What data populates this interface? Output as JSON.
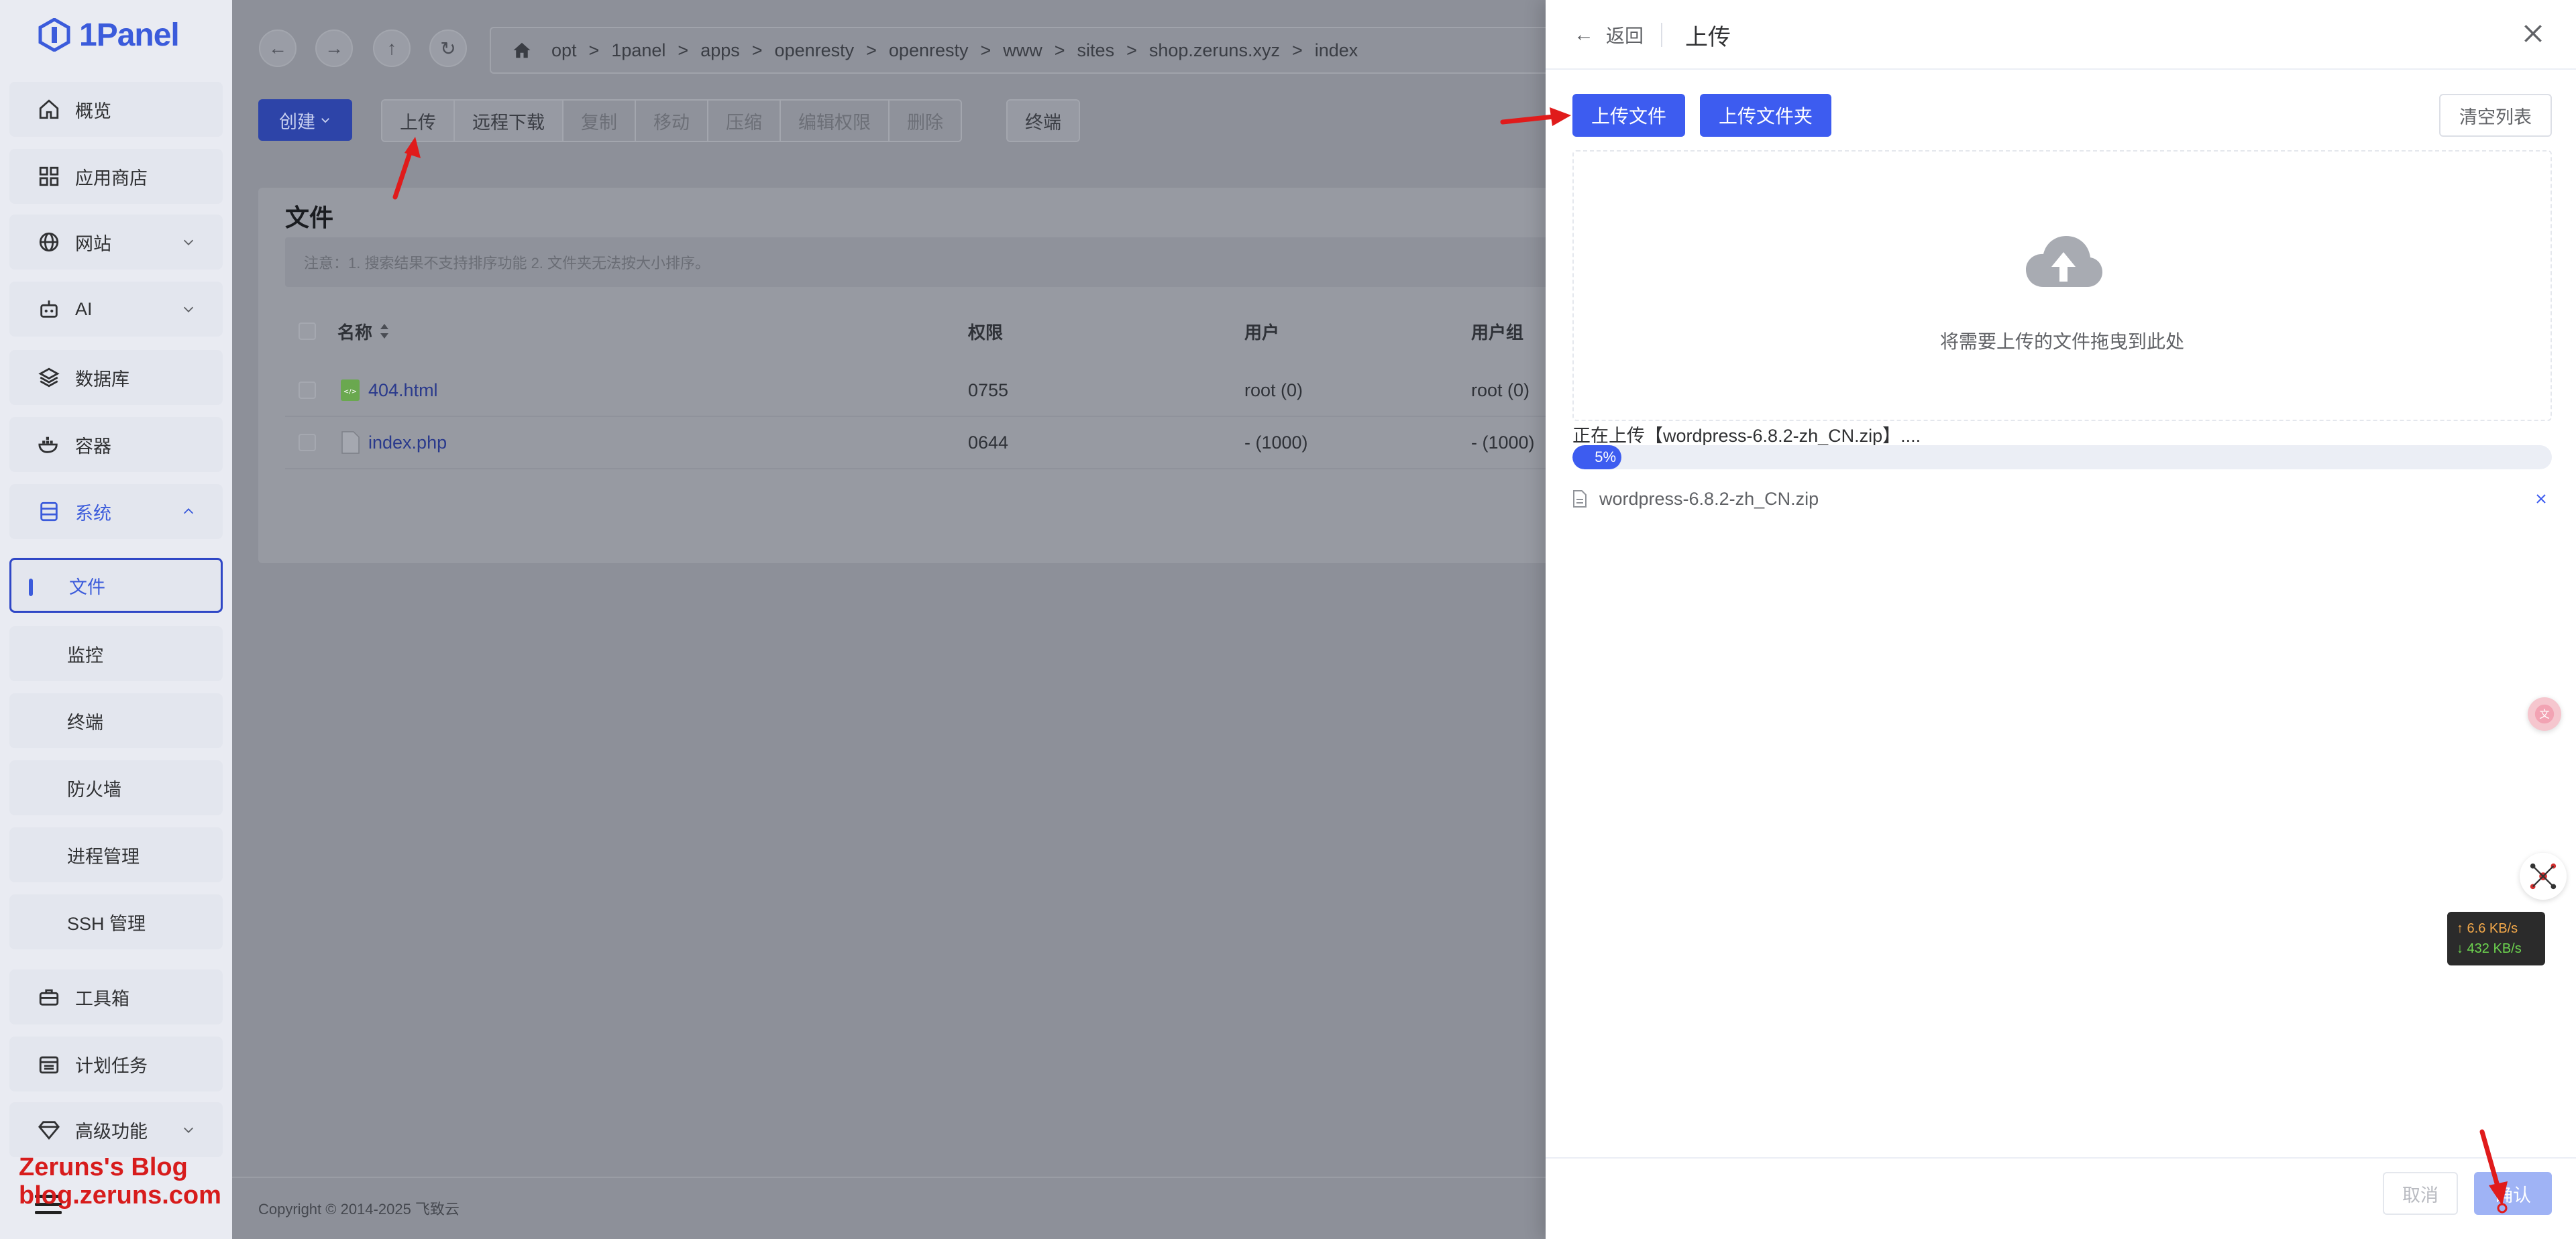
{
  "app": {
    "logo_text": "1Panel"
  },
  "sidebar": {
    "items": [
      {
        "label": "概览",
        "icon": "home-icon"
      },
      {
        "label": "应用商店",
        "icon": "grid-icon"
      },
      {
        "label": "网站",
        "icon": "globe-icon"
      },
      {
        "label": "AI",
        "icon": "robot-icon"
      },
      {
        "label": "数据库",
        "icon": "layers-icon"
      },
      {
        "label": "容器",
        "icon": "docker-icon"
      },
      {
        "label": "系统",
        "icon": "server-icon"
      }
    ],
    "system_sub": [
      {
        "label": "文件"
      },
      {
        "label": "监控"
      },
      {
        "label": "终端"
      },
      {
        "label": "防火墙"
      },
      {
        "label": "进程管理"
      },
      {
        "label": "SSH 管理"
      }
    ],
    "bottom_items": [
      {
        "label": "工具箱",
        "icon": "toolbox-icon"
      },
      {
        "label": "计划任务",
        "icon": "calendar-icon"
      },
      {
        "label": "高级功能",
        "icon": "diamond-icon"
      }
    ]
  },
  "path": {
    "segments": [
      "opt",
      "1panel",
      "apps",
      "openresty",
      "openresty",
      "www",
      "sites",
      "shop.zeruns.xyz",
      "index"
    ],
    "separator": ">"
  },
  "toolbar": {
    "create": "创建",
    "buttons": [
      "上传",
      "远程下载",
      "复制",
      "移动",
      "压缩",
      "编辑权限",
      "删除"
    ],
    "terminal": "终端"
  },
  "files_card": {
    "title": "文件",
    "notice": "注意：1. 搜索结果不支持排序功能 2. 文件夹无法按大小排序。",
    "columns": {
      "name": "名称",
      "perm": "权限",
      "user": "用户",
      "group": "用户组"
    },
    "rows": [
      {
        "name": "404.html",
        "perm": "0755",
        "user": "root (0)",
        "group": "root (0)"
      },
      {
        "name": "index.php",
        "perm": "0644",
        "user": "- (1000)",
        "group": "- (1000)"
      }
    ]
  },
  "footer": {
    "copyright": "Copyright © 2014-2025 飞致云"
  },
  "drawer": {
    "back": "返回",
    "title": "上传",
    "upload_file": "上传文件",
    "upload_folder": "上传文件夹",
    "clear_list": "清空列表",
    "drop_text": "将需要上传的文件拖曳到此处",
    "uploading_text": "正在上传【wordpress-6.8.2-zh_CN.zip】....",
    "progress_percent": 5,
    "progress_label": "5%",
    "file_name": "wordpress-6.8.2-zh_CN.zip",
    "cancel": "取消",
    "confirm": "确认"
  },
  "speed": {
    "up": "↑ 6.6 KB/s",
    "down": "↓ 432 KB/s"
  },
  "watermark": {
    "line1": "Zeruns's Blog",
    "line2": "blog.zeruns.com"
  },
  "colors": {
    "primary": "#3d5cf0",
    "brand": "#3b5bdb",
    "annotation": "#e01b1b"
  }
}
